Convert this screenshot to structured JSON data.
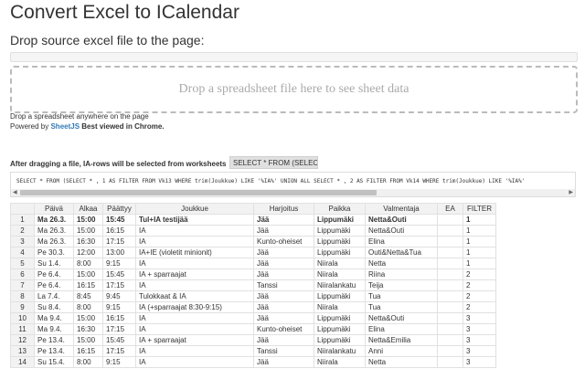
{
  "page": {
    "title": "Convert Excel to ICalendar",
    "subtitle": "Drop source excel file to the page:"
  },
  "dropzone": {
    "label": "Drop a spreadsheet file here to see sheet data"
  },
  "hint": "Drop a spreadsheet anywhere on the page",
  "powered": {
    "prefix": "Powered by ",
    "link": "SheetJS",
    "suffix": " Best viewed in Chrome."
  },
  "query": {
    "label": "After dragging a file, IA-rows will be selected from worksheets",
    "button_label": "SELECT * FROM (SELECT",
    "sql": "SELECT * FROM (SELECT * , 1 AS FILTER FROM Vk13 WHERE trim(Joukkue) LIKE '%IA%'  UNION ALL SELECT * , 2 AS FILTER FROM Vk14 WHERE trim(Joukkue) LIKE '%IA%'"
  },
  "table": {
    "columns": [
      "",
      "Päivä",
      "Alkaa",
      "Päättyy",
      "Joukkue",
      "Harjoitus",
      "Paikka",
      "Valmentaja",
      "EA",
      "FILTER"
    ],
    "rows": [
      [
        "1",
        "Ma 26.3.",
        "15:00",
        "15:45",
        "Tul+IA testijää",
        "Jää",
        "Lippumäki",
        "Netta&Outi",
        "",
        "1"
      ],
      [
        "2",
        "Ma 26.3.",
        "15:00",
        "16:15",
        "IA",
        "Jää",
        "Lippumäki",
        "Netta&Outi",
        "",
        "1"
      ],
      [
        "3",
        "Ma 26.3.",
        "16:30",
        "17:15",
        "IA",
        "Kunto-oheiset",
        "Lippumäki",
        "Elina",
        "",
        "1"
      ],
      [
        "4",
        "Pe 30.3.",
        "12:00",
        "13:00",
        "IA+IE (violetit minionit)",
        "Jää",
        "Lippumäki",
        "Outi&Netta&Tua",
        "",
        "1"
      ],
      [
        "5",
        "Su 1.4.",
        "8:00",
        "9:15",
        "IA",
        "Jää",
        "Niirala",
        "Netta",
        "",
        "1"
      ],
      [
        "6",
        "Pe 6.4.",
        "15:00",
        "15:45",
        "IA + sparraajat",
        "Jää",
        "Niirala",
        "Riina",
        "",
        "2"
      ],
      [
        "7",
        "Pe 6.4.",
        "16:15",
        "17:15",
        "IA",
        "Tanssi",
        "Niiralankatu",
        "Teija",
        "",
        "2"
      ],
      [
        "8",
        "La 7.4.",
        "8:45",
        "9:45",
        "Tulokkaat & IA",
        "Jää",
        "Lippumäki",
        "Tua",
        "",
        "2"
      ],
      [
        "9",
        "Su 8.4.",
        "8:00",
        "9:15",
        "IA (+sparraajat 8:30-9:15)",
        "Jää",
        "Niirala",
        "Tua",
        "",
        "2"
      ],
      [
        "10",
        "Ma 9.4.",
        "15:00",
        "16:15",
        "IA",
        "Jää",
        "Lippumäki",
        "Netta&Outi",
        "",
        "3"
      ],
      [
        "11",
        "Ma 9.4.",
        "16:30",
        "17:15",
        "IA",
        "Kunto-oheiset",
        "Lippumäki",
        "Elina",
        "",
        "3"
      ],
      [
        "12",
        "Pe 13.4.",
        "15:00",
        "15:45",
        "IA + sparraajat",
        "Jää",
        "Lippumäki",
        "Netta&Emilia",
        "",
        "3"
      ],
      [
        "13",
        "Pe 13.4.",
        "16:15",
        "17:15",
        "IA",
        "Tanssi",
        "Niiralankatu",
        "Anni",
        "",
        "3"
      ],
      [
        "14",
        "Su 15.4.",
        "8:00",
        "9:15",
        "IA",
        "Jää",
        "Niirala",
        "Netta",
        "",
        "3"
      ]
    ]
  }
}
